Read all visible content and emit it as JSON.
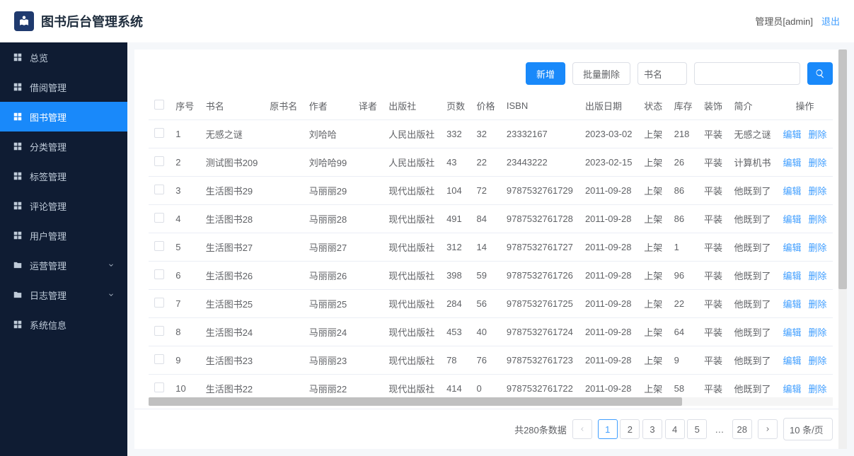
{
  "header": {
    "app_title": "图书后台管理系统",
    "user_label": "管理员[admin]",
    "logout": "退出"
  },
  "sidebar": {
    "items": [
      {
        "label": "总览",
        "icon": "grid",
        "active": false
      },
      {
        "label": "借阅管理",
        "icon": "grid",
        "active": false
      },
      {
        "label": "图书管理",
        "icon": "grid",
        "active": true
      },
      {
        "label": "分类管理",
        "icon": "grid",
        "active": false
      },
      {
        "label": "标签管理",
        "icon": "grid",
        "active": false
      },
      {
        "label": "评论管理",
        "icon": "grid",
        "active": false
      },
      {
        "label": "用户管理",
        "icon": "grid",
        "active": false
      },
      {
        "label": "运营管理",
        "icon": "folder",
        "expandable": true
      },
      {
        "label": "日志管理",
        "icon": "folder",
        "expandable": true
      },
      {
        "label": "系统信息",
        "icon": "grid",
        "active": false
      }
    ]
  },
  "toolbar": {
    "add_label": "新增",
    "batch_delete_label": "批量删除",
    "search_field_selected": "书名",
    "search_placeholder": ""
  },
  "table": {
    "columns": [
      "序号",
      "书名",
      "原书名",
      "作者",
      "译者",
      "出版社",
      "页数",
      "价格",
      "ISBN",
      "出版日期",
      "状态",
      "库存",
      "装饰",
      "简介",
      "操作"
    ],
    "edit_label": "编辑",
    "delete_label": "删除",
    "rows": [
      {
        "seq": "1",
        "title": "无感之谜",
        "orig": "",
        "author": "刘哈哈",
        "translator": "",
        "publisher": "人民出版社",
        "pages": "332",
        "price": "32",
        "isbn": "23332167",
        "pubdate": "2023-03-02",
        "status": "上架",
        "stock": "218",
        "binding": "平装",
        "desc": "无感之谜"
      },
      {
        "seq": "2",
        "title": "测试图书209",
        "orig": "",
        "author": "刘哈哈99",
        "translator": "",
        "publisher": "人民出版社",
        "pages": "43",
        "price": "22",
        "isbn": "23443222",
        "pubdate": "2023-02-15",
        "status": "上架",
        "stock": "26",
        "binding": "平装",
        "desc": "计算机书"
      },
      {
        "seq": "3",
        "title": "生活图书29",
        "orig": "",
        "author": "马丽丽29",
        "translator": "",
        "publisher": "现代出版社",
        "pages": "104",
        "price": "72",
        "isbn": "9787532761729",
        "pubdate": "2011-09-28",
        "status": "上架",
        "stock": "86",
        "binding": "平装",
        "desc": "他既到了"
      },
      {
        "seq": "4",
        "title": "生活图书28",
        "orig": "",
        "author": "马丽丽28",
        "translator": "",
        "publisher": "现代出版社",
        "pages": "491",
        "price": "84",
        "isbn": "9787532761728",
        "pubdate": "2011-09-28",
        "status": "上架",
        "stock": "86",
        "binding": "平装",
        "desc": "他既到了"
      },
      {
        "seq": "5",
        "title": "生活图书27",
        "orig": "",
        "author": "马丽丽27",
        "translator": "",
        "publisher": "现代出版社",
        "pages": "312",
        "price": "14",
        "isbn": "9787532761727",
        "pubdate": "2011-09-28",
        "status": "上架",
        "stock": "1",
        "binding": "平装",
        "desc": "他既到了"
      },
      {
        "seq": "6",
        "title": "生活图书26",
        "orig": "",
        "author": "马丽丽26",
        "translator": "",
        "publisher": "现代出版社",
        "pages": "398",
        "price": "59",
        "isbn": "9787532761726",
        "pubdate": "2011-09-28",
        "status": "上架",
        "stock": "96",
        "binding": "平装",
        "desc": "他既到了"
      },
      {
        "seq": "7",
        "title": "生活图书25",
        "orig": "",
        "author": "马丽丽25",
        "translator": "",
        "publisher": "现代出版社",
        "pages": "284",
        "price": "56",
        "isbn": "9787532761725",
        "pubdate": "2011-09-28",
        "status": "上架",
        "stock": "22",
        "binding": "平装",
        "desc": "他既到了"
      },
      {
        "seq": "8",
        "title": "生活图书24",
        "orig": "",
        "author": "马丽丽24",
        "translator": "",
        "publisher": "现代出版社",
        "pages": "453",
        "price": "40",
        "isbn": "9787532761724",
        "pubdate": "2011-09-28",
        "status": "上架",
        "stock": "64",
        "binding": "平装",
        "desc": "他既到了"
      },
      {
        "seq": "9",
        "title": "生活图书23",
        "orig": "",
        "author": "马丽丽23",
        "translator": "",
        "publisher": "现代出版社",
        "pages": "78",
        "price": "76",
        "isbn": "9787532761723",
        "pubdate": "2011-09-28",
        "status": "上架",
        "stock": "9",
        "binding": "平装",
        "desc": "他既到了"
      },
      {
        "seq": "10",
        "title": "生活图书22",
        "orig": "",
        "author": "马丽丽22",
        "translator": "",
        "publisher": "现代出版社",
        "pages": "414",
        "price": "0",
        "isbn": "9787532761722",
        "pubdate": "2011-09-28",
        "status": "上架",
        "stock": "58",
        "binding": "平装",
        "desc": "他既到了"
      }
    ]
  },
  "pagination": {
    "total_label": "共280条数据",
    "pages": [
      "1",
      "2",
      "3",
      "4",
      "5",
      "…",
      "28"
    ],
    "current": "1",
    "size_label": "10 条/页"
  }
}
